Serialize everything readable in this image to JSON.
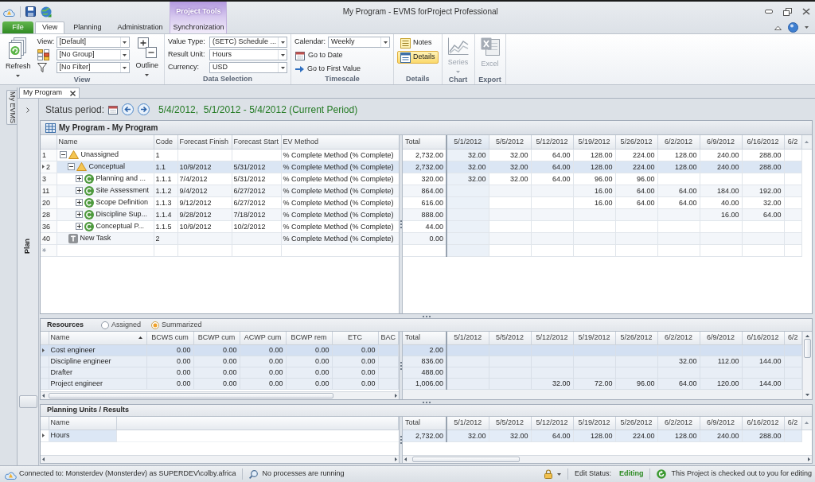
{
  "window": {
    "title": "My Program - EVMS forProject Professional"
  },
  "ribbon": {
    "contextual_title": "Project Tools",
    "tabs": [
      {
        "label": "File",
        "kind": "file",
        "selected": false
      },
      {
        "label": "View",
        "kind": "normal",
        "selected": true
      },
      {
        "label": "Planning",
        "kind": "normal",
        "selected": false
      },
      {
        "label": "Administration",
        "kind": "normal",
        "selected": false
      },
      {
        "label": "Synchronization",
        "kind": "contextual",
        "selected": false
      }
    ],
    "view_group": {
      "label": "View",
      "refresh": {
        "label": "Refresh"
      },
      "view_combo": {
        "label": "View:",
        "value": "[Default]"
      },
      "group_combo": {
        "value": "[No Group]"
      },
      "filter_combo": {
        "value": "[No Filter]"
      },
      "outline": {
        "label": "Outline"
      }
    },
    "data_selection_group": {
      "label": "Data Selection",
      "fields": [
        {
          "label": "Value Type:",
          "value": "(SETC) Schedule ..."
        },
        {
          "label": "Result Unit:",
          "value": "Hours"
        },
        {
          "label": "Currency:",
          "value": "USD"
        }
      ]
    },
    "timescale_group": {
      "label": "Timescale",
      "calendar": {
        "label": "Calendar:",
        "value": "Weekly"
      },
      "go_to_date": {
        "label": "Go to Date"
      },
      "go_to_first_value": {
        "label": "Go to First Value"
      }
    },
    "details_group": {
      "label": "Details",
      "buttons": [
        {
          "label": "Notes",
          "kind": "notes",
          "selected": false
        },
        {
          "label": "Details",
          "kind": "details",
          "selected": true
        }
      ]
    },
    "chart_group": {
      "label": "Chart",
      "series": {
        "label": "Series",
        "disabled": true
      }
    },
    "export_group": {
      "label": "Export",
      "excel": {
        "label": "Excel",
        "disabled": true
      }
    }
  },
  "side_tab": {
    "label": "My EVMS"
  },
  "document_tabs": [
    {
      "label": "My Program",
      "selected": true
    }
  ],
  "side_panel": {
    "label": "Plan"
  },
  "status_period": {
    "label": "Status period:",
    "value": "5/4/2012,  5/1/2012 - 5/4/2012 (Current Period)"
  },
  "plan": {
    "title": "My Program - My Program",
    "columns": [
      "Name",
      "Code",
      "Forecast Finish",
      "Forecast Start",
      "EV Method"
    ],
    "total_column": "Total",
    "period_columns": [
      {
        "label": "5/1/2012",
        "current": true
      },
      {
        "label": "5/5/2012",
        "current": false
      },
      {
        "label": "5/12/2012",
        "current": false
      },
      {
        "label": "5/19/2012",
        "current": false
      },
      {
        "label": "5/26/2012",
        "current": false
      },
      {
        "label": "6/2/2012",
        "current": false
      },
      {
        "label": "6/9/2012",
        "current": false
      },
      {
        "label": "6/16/2012",
        "current": false
      },
      {
        "label": "6/2",
        "current": false
      }
    ],
    "rows": [
      {
        "number": "1",
        "name": "Unassigned",
        "kind": "summary",
        "expanded": true,
        "selected": false,
        "code": "1",
        "ev_method": "% Complete Method (% Complete)",
        "total": "2,732.00",
        "weeks": {
          "week_1": "32.00",
          "week_2": "32.00",
          "week_3": "64.00",
          "week_4": "128.00",
          "week_5": "224.00",
          "week_6": "128.00",
          "week_7": "240.00",
          "week_8": "288.00"
        },
        "children": [
          {
            "number": "2",
            "name": "Conceptual",
            "kind": "summary",
            "expanded": true,
            "selected": true,
            "code": "1.1",
            "forecast_finish": "10/9/2012",
            "forecast_start": "5/31/2012",
            "ev_method": "% Complete Method (% Complete)",
            "total": "2,732.00",
            "weeks": {
              "week_1": "32.00",
              "week_2": "32.00",
              "week_3": "64.00",
              "week_4": "128.00",
              "week_5": "224.00",
              "week_6": "128.00",
              "week_7": "240.00",
              "week_8": "288.00"
            },
            "children": [
              {
                "number": "3",
                "name": "Planning and ...",
                "kind": "control",
                "expanded": false,
                "selected": false,
                "code": "1.1.1",
                "forecast_finish": "7/4/2012",
                "forecast_start": "5/31/2012",
                "ev_method": "% Complete Method (% Complete)",
                "total": "320.00",
                "weeks": {
                  "week_1": "32.00",
                  "week_2": "32.00",
                  "week_3": "64.00",
                  "week_4": "96.00",
                  "week_5": "96.00"
                }
              },
              {
                "number": "11",
                "name": "Site Assessment",
                "kind": "control",
                "expanded": false,
                "selected": false,
                "code": "1.1.2",
                "forecast_finish": "9/4/2012",
                "forecast_start": "6/27/2012",
                "ev_method": "% Complete Method (% Complete)",
                "total": "864.00",
                "weeks": {
                  "week_4": "16.00",
                  "week_5": "64.00",
                  "week_6": "64.00",
                  "week_7": "184.00",
                  "week_8": "192.00"
                }
              },
              {
                "number": "20",
                "name": "Scope Definition",
                "kind": "control",
                "expanded": false,
                "selected": false,
                "code": "1.1.3",
                "forecast_finish": "9/12/2012",
                "forecast_start": "6/27/2012",
                "ev_method": "% Complete Method (% Complete)",
                "total": "616.00",
                "weeks": {
                  "week_4": "16.00",
                  "week_5": "64.00",
                  "week_6": "64.00",
                  "week_7": "40.00",
                  "week_8": "32.00"
                }
              },
              {
                "number": "28",
                "name": "Discipline Sup...",
                "kind": "control",
                "expanded": false,
                "selected": false,
                "code": "1.1.4",
                "forecast_finish": "9/28/2012",
                "forecast_start": "7/18/2012",
                "ev_method": "% Complete Method (% Complete)",
                "total": "888.00",
                "weeks": {
                  "week_7": "16.00",
                  "week_8": "64.00"
                }
              },
              {
                "number": "36",
                "name": "Conceptual P...",
                "kind": "control",
                "expanded": false,
                "selected": false,
                "code": "1.1.5",
                "forecast_finish": "10/9/2012",
                "forecast_start": "10/2/2012",
                "ev_method": "% Complete Method (% Complete)",
                "total": "44.00"
              }
            ]
          }
        ]
      },
      {
        "number": "40",
        "name": "New Task",
        "kind": "task",
        "selected": false,
        "code": "2",
        "ev_method": "% Complete Method (% Complete)",
        "total": "0.00"
      }
    ]
  },
  "resources": {
    "title": "Resources",
    "options": [
      {
        "label": "Assigned",
        "selected": false
      },
      {
        "label": "Summarized",
        "selected": true
      }
    ],
    "columns": [
      {
        "label": "Name",
        "sorted": true
      },
      {
        "label": "BCWS cum",
        "sorted": false
      },
      {
        "label": "BCWP cum",
        "sorted": false
      },
      {
        "label": "ACWP cum",
        "sorted": false
      },
      {
        "label": "BCWP rem",
        "sorted": false
      },
      {
        "label": "ETC",
        "sorted": false
      },
      {
        "label": "BAC",
        "sorted": false
      }
    ],
    "total_column": "Total",
    "period_columns": [
      "5/1/2012",
      "5/5/2012",
      "5/12/2012",
      "5/19/2012",
      "5/26/2012",
      "6/2/2012",
      "6/9/2012",
      "6/16/2012",
      "6/2"
    ],
    "rows": [
      {
        "name": "Cost engineer",
        "selected": true,
        "values": [
          "0.00",
          "0.00",
          "0.00",
          "0.00",
          "0.00"
        ],
        "total": "2.00"
      },
      {
        "name": "Discipline engineer",
        "selected": false,
        "values": [
          "0.00",
          "0.00",
          "0.00",
          "0.00",
          "0.00"
        ],
        "total": "836.00",
        "weeks": {
          "week_6": "32.00",
          "week_7": "112.00",
          "week_8": "144.00"
        }
      },
      {
        "name": "Drafter",
        "selected": false,
        "values": [
          "0.00",
          "0.00",
          "0.00",
          "0.00",
          "0.00"
        ],
        "total": "488.00"
      },
      {
        "name": "Project engineer",
        "selected": false,
        "values": [
          "0.00",
          "0.00",
          "0.00",
          "0.00",
          "0.00"
        ],
        "total": "1,006.00",
        "weeks": {
          "week_3": "32.00",
          "week_4": "72.00",
          "week_5": "96.00",
          "week_6": "64.00",
          "week_7": "120.00",
          "week_8": "144.00"
        }
      }
    ]
  },
  "planning_units": {
    "title": "Planning Units / Results",
    "columns": [
      "Name"
    ],
    "total_column": "Total",
    "period_columns": [
      "5/1/2012",
      "5/5/2012",
      "5/12/2012",
      "5/19/2012",
      "5/26/2012",
      "6/2/2012",
      "6/9/2012",
      "6/16/2012",
      "6/2"
    ],
    "rows": [
      {
        "name": "Hours",
        "selected": true,
        "total": "2,732.00",
        "weeks": {
          "week_1": "32.00",
          "week_2": "32.00",
          "week_3": "64.00",
          "week_4": "128.00",
          "week_5": "224.00",
          "week_6": "128.00",
          "week_7": "240.00",
          "week_8": "288.00"
        }
      }
    ]
  },
  "status_bar": {
    "connection": "Connected to: Monsterdev (Monsterdev) as SUPERDEV\\colby.africa",
    "processes": "No processes are running",
    "edit_status_label": "Edit Status:",
    "edit_status": "Editing",
    "checkout": "This Project is checked out to you for editing"
  }
}
